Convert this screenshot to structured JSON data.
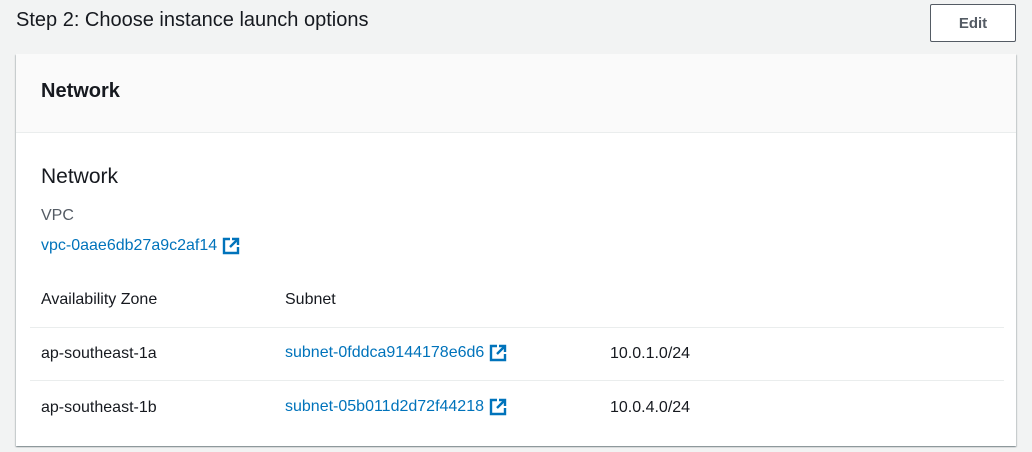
{
  "step": {
    "title": "Step 2: Choose instance launch options",
    "edit_label": "Edit"
  },
  "panel": {
    "header": "Network",
    "section_title": "Network",
    "vpc_label": "VPC",
    "vpc_value": "vpc-0aae6db27a9c2af14",
    "columns": [
      "Availability Zone",
      "Subnet"
    ],
    "rows": [
      {
        "az": "ap-southeast-1a",
        "subnet": "subnet-0fddca9144178e6d6",
        "cidr": "10.0.1.0/24"
      },
      {
        "az": "ap-southeast-1b",
        "subnet": "subnet-05b011d2d72f44218",
        "cidr": "10.0.4.0/24"
      }
    ]
  },
  "colors": {
    "link": "#0073bb",
    "text": "#16191f",
    "muted": "#545b64",
    "page_bg": "#f2f3f3"
  },
  "icons": {
    "external_link": "external-link-icon"
  }
}
